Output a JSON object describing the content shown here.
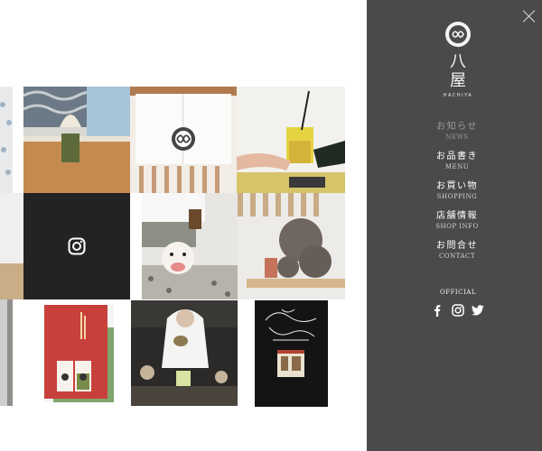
{
  "brand": {
    "kanji_top": "八",
    "kanji_bottom": "屋",
    "latin": "HACHIYA"
  },
  "menu": {
    "items": [
      {
        "jp": "お知らせ",
        "en": "NEWS"
      },
      {
        "jp": "お品書き",
        "en": "MENU"
      },
      {
        "jp": "お買い物",
        "en": "SHOPPING"
      },
      {
        "jp": "店舗情報",
        "en": "SHOP INFO"
      },
      {
        "jp": "お問合せ",
        "en": "CONTACT"
      }
    ]
  },
  "official": {
    "label": "OFFICIAL",
    "icons": [
      "facebook-icon",
      "instagram-icon",
      "twitter-icon"
    ]
  },
  "colors": {
    "panel": "#4a4a4a",
    "instagram_tile": "#232323",
    "accent_red": "#c8403c"
  }
}
